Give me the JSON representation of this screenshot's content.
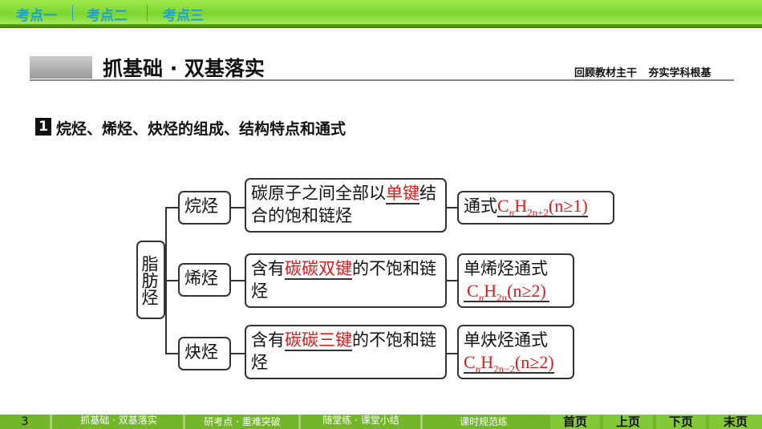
{
  "topnav": {
    "tabs": [
      "考点一",
      "考点二",
      "考点三"
    ]
  },
  "header": {
    "title": "抓基础 · 双基落实",
    "subtitle": "回顾教材主干 夯实学科根基"
  },
  "section": {
    "number": "1",
    "title": "烷烃、烯烃、炔烃的组成、结构特点和通式"
  },
  "diagram": {
    "root": "脂肪烃",
    "branches": [
      {
        "name": "烷烃",
        "desc_pre": "碳原子之间全部以",
        "desc_key": "单键",
        "desc_post": "结合的饱和链烃",
        "formula_label": "通式",
        "formula": {
          "c": "C",
          "n": "n",
          "h": "H",
          "sub": "2n+2",
          "cond": "(n≥1)"
        }
      },
      {
        "name": "烯烃",
        "desc_pre": "含有",
        "desc_key": "碳碳双键",
        "desc_post": "的不饱和链烃",
        "formula_label": "单烯烃通式",
        "formula": {
          "c": "C",
          "n": "n",
          "h": "H",
          "sub": "2n",
          "cond": "(n≥2)"
        }
      },
      {
        "name": "炔烃",
        "desc_pre": "含有",
        "desc_key": "碳碳三键",
        "desc_post": "的不饱和链烃",
        "formula_label": "单炔烃通式",
        "formula": {
          "c": "C",
          "n": "n",
          "h": "H",
          "sub": "2n−2",
          "cond": "(n≥2)"
        }
      }
    ]
  },
  "footer": {
    "page": "3",
    "links": [
      "抓基础 · 双基落实",
      "研考点 · 重难突破",
      "随堂练 · 课堂小结",
      "课时规范练"
    ],
    "nav": [
      "首页",
      "上页",
      "下页",
      "末页"
    ]
  }
}
